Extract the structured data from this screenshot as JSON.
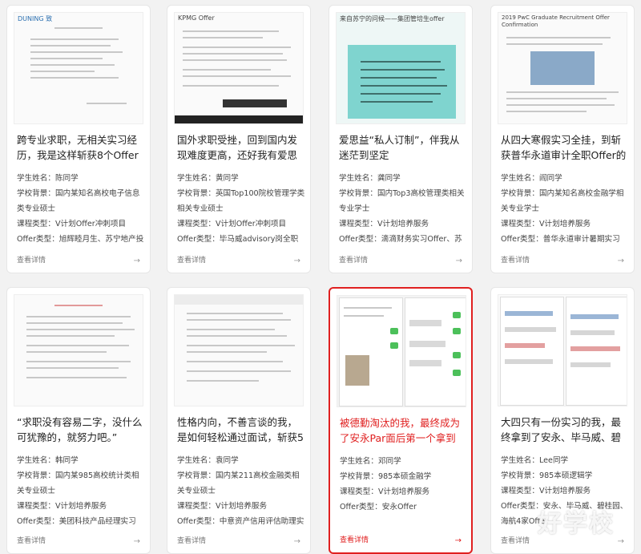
{
  "labels": {
    "name_prefix": "学生姓名：",
    "school_prefix": "学校背景：",
    "course_prefix": "课程类型：",
    "offer_prefix": "Offer类型：",
    "more": "查看详情",
    "arrow": "→"
  },
  "cards": [
    {
      "title": "跨专业求职，无相关实习经历，我是这样斩获8个Offer",
      "name": "陈同学",
      "school": "国内某知名高校电子信息类专业硕士",
      "course": "V计划Offer冲刺项目",
      "offer": "旭辉睦月生、苏宁地产投资岗、招商蛇口营销管培、蓝城集",
      "thumb_caption": "DUNING 致"
    },
    {
      "title": "国外求职受挫，回到国内发现难度更高，还好我有爱思",
      "name": "黄同学",
      "school": "英国Top100院校管理学类相关专业硕士",
      "course": "V计划Offer冲刺项目",
      "offer": "毕马威advisory岗全职offer",
      "thumb_caption": "KPMG Offer"
    },
    {
      "title": "爱思益“私人订制”，伴我从迷茫到坚定",
      "name": "龚同学",
      "school": "国内Top3高校管理类相关专业学士",
      "course": "V计划培养服务",
      "offer": "滴滴财务实习Offer、苏宁集团管培生全职Offer、华为销售",
      "thumb_caption": "来自苏宁的问候——集团管培生offer"
    },
    {
      "title": "从四大寒假实习全挂，到斩获普华永道审计全职Offer的",
      "name": "阎同学",
      "school": "国内某知名高校金融学相关专业学士",
      "course": "V计划培养服务",
      "offer": "普华永道审计暑期实习Offer、普华永道审计全职Offer",
      "thumb_caption": "2019 PwC Graduate Recruitment Offer Confirmation"
    },
    {
      "title": "“求职没有容易二字，没什么可犹豫的，就努力吧。”",
      "name": "韩同学",
      "school": "国内某985高校统计类相关专业硕士",
      "course": "V计划培养服务",
      "offer": "美团科技产品经理实习Offer、小红书产品经理全职Offer",
      "thumb_caption": ""
    },
    {
      "title": "性格内向，不善言谈的我，是如何轻松通过面试，斩获5",
      "name": "袁同学",
      "school": "国内某211高校金融类相关专业硕士",
      "course": "V计划培养服务",
      "offer": "中意资产信用评估助理实习、国盛宏观研究员助理实习、清",
      "thumb_caption": ""
    },
    {
      "title": "被德勤淘汰的我，最终成为了安永Par面后第一个拿到",
      "name": "邓同学",
      "school": "985本硕金融学",
      "course": "V计划培养服务",
      "offer": "安永Offer",
      "thumb_caption": ""
    },
    {
      "title": "大四只有一份实习的我，最终拿到了安永、毕马威、碧",
      "name": "Lee同学",
      "school": "985本硕逻辑学",
      "course": "V计划培养服务",
      "offer": "安永、毕马威、碧桂园、海航4家Offer",
      "thumb_caption": ""
    }
  ],
  "watermark": "好学校"
}
